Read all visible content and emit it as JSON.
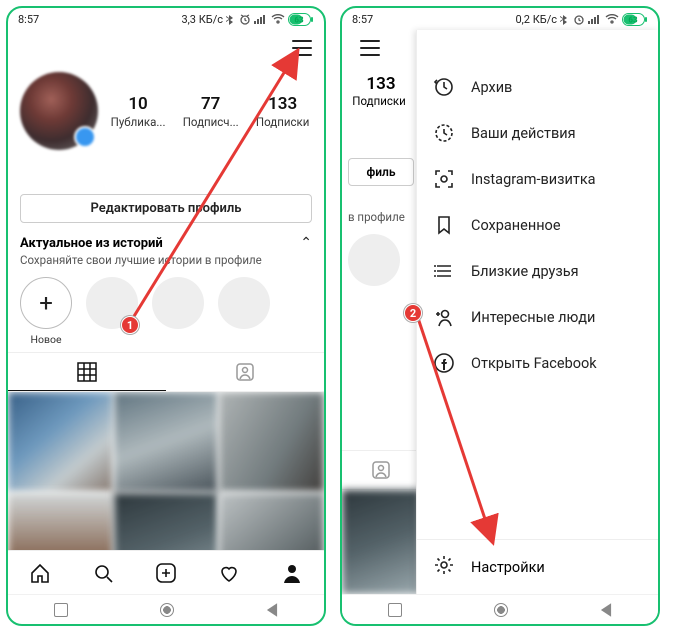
{
  "status": {
    "time": "8:57",
    "net1": "3,3 КБ/с",
    "net2": "0,2 КБ/с",
    "battery": "63"
  },
  "profile": {
    "stats": [
      {
        "num": "10",
        "lbl": "Публика..."
      },
      {
        "num": "77",
        "lbl": "Подписч..."
      },
      {
        "num": "133",
        "lbl": "Подписки"
      }
    ],
    "editBtn": "Редактировать профиль",
    "highlights": {
      "title": "Актуальное из историй",
      "subtitle": "Сохраняйте свои лучшие истории в профиле",
      "newLabel": "Новое"
    }
  },
  "strip": {
    "stat_num": "133",
    "stat_lbl": "Подписки",
    "edit": "филь",
    "sub": "в профиле"
  },
  "menu": {
    "items": [
      "Архив",
      "Ваши действия",
      "Instagram-визитка",
      "Сохраненное",
      "Близкие друзья",
      "Интересные люди",
      "Открыть Facebook"
    ],
    "settings": "Настройки"
  },
  "badges": {
    "one": "1",
    "two": "2"
  }
}
